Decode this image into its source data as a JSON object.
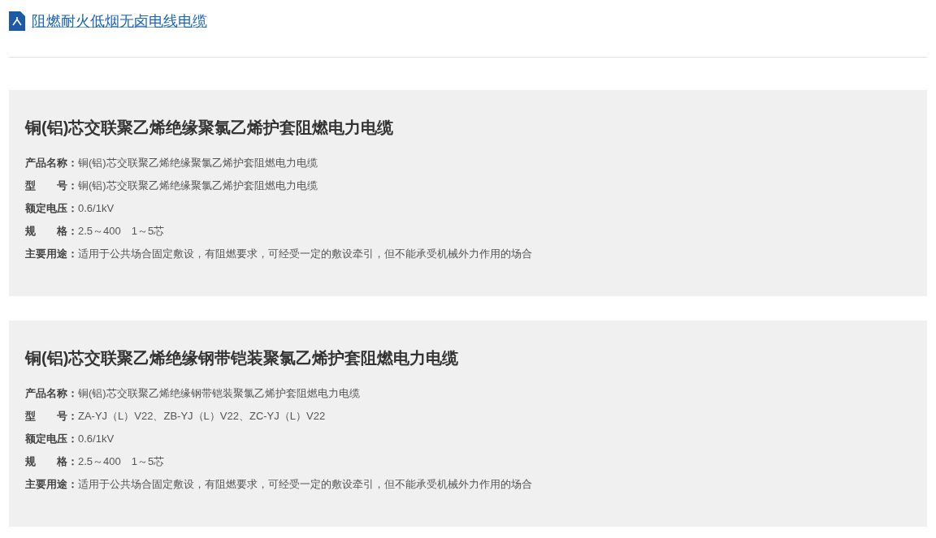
{
  "download_link": {
    "label": "阻燃耐火低烟无卤电线电缆"
  },
  "products": [
    {
      "title": "铜(铝)芯交联聚乙烯绝缘聚氯乙烯护套阻燃电力电缆",
      "specs": [
        {
          "label": "产品名称：",
          "value": "铜(铝)芯交联聚乙烯绝缘聚氯乙烯护套阻燃电力电缆"
        },
        {
          "label": "型　　号：",
          "value": "铜(铝)芯交联聚乙烯绝缘聚氯乙烯护套阻燃电力电缆"
        },
        {
          "label": "额定电压：",
          "value": "0.6/1kV"
        },
        {
          "label": "规　　格：",
          "value": "2.5～400　1～5芯"
        },
        {
          "label": "主要用途：",
          "value": "适用于公共场合固定敷设，有阻燃要求，可经受一定的敷设牵引，但不能承受机械外力作用的场合"
        }
      ]
    },
    {
      "title": "铜(铝)芯交联聚乙烯绝缘钢带铠装聚氯乙烯护套阻燃电力电缆",
      "specs": [
        {
          "label": "产品名称：",
          "value": "铜(铝)芯交联聚乙烯绝缘钢带铠装聚氯乙烯护套阻燃电力电缆"
        },
        {
          "label": "型　　号：",
          "value": "ZA-YJ（L）V22、ZB-YJ（L）V22、ZC-YJ（L）V22"
        },
        {
          "label": "额定电压：",
          "value": "0.6/1kV"
        },
        {
          "label": "规　　格：",
          "value": "2.5～400　1～5芯"
        },
        {
          "label": "主要用途：",
          "value": "适用于公共场合固定敷设，有阻燃要求，可经受一定的敷设牵引，但不能承受机械外力作用的场合"
        }
      ]
    }
  ]
}
